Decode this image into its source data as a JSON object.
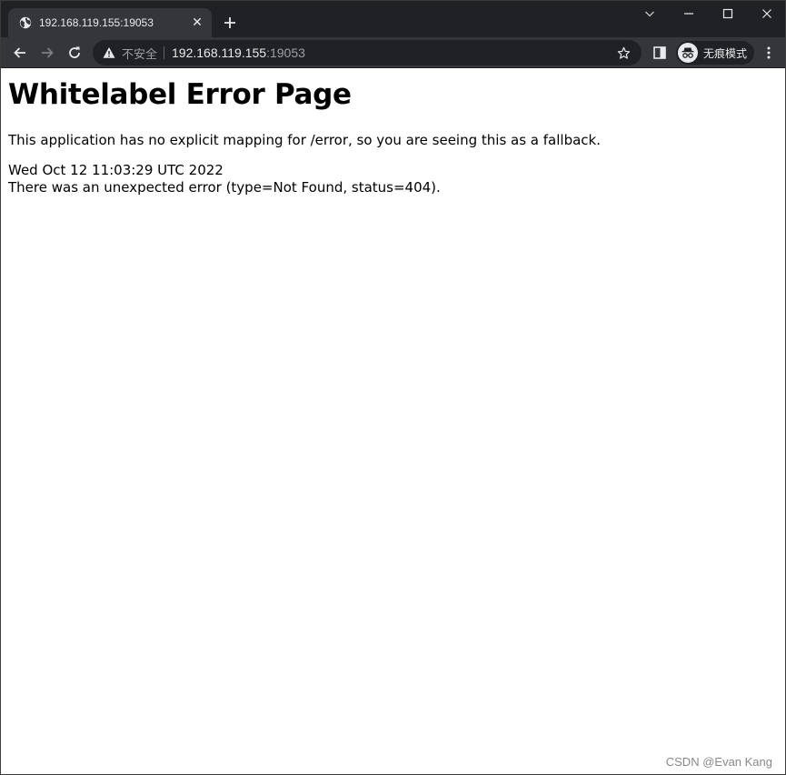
{
  "browser": {
    "tab": {
      "title": "192.168.119.155:19053",
      "favicon": "globe-icon",
      "close_glyph": "✕"
    },
    "toolbar": {
      "security_label": "不安全",
      "url_host": "192.168.119.155",
      "url_port": ":19053",
      "incognito_label": "无痕模式"
    },
    "colors": {
      "frame": "#202124",
      "toolbar": "#35363a",
      "text": "#e8eaed",
      "muted": "#9aa0a6"
    }
  },
  "page": {
    "heading": "Whitelabel Error Page",
    "description": "This application has no explicit mapping for /error, so you are seeing this as a fallback.",
    "timestamp": "Wed Oct 12 11:03:29 UTC 2022",
    "error_message": "There was an unexpected error (type=Not Found, status=404)."
  },
  "watermark": "CSDN @Evan Kang"
}
